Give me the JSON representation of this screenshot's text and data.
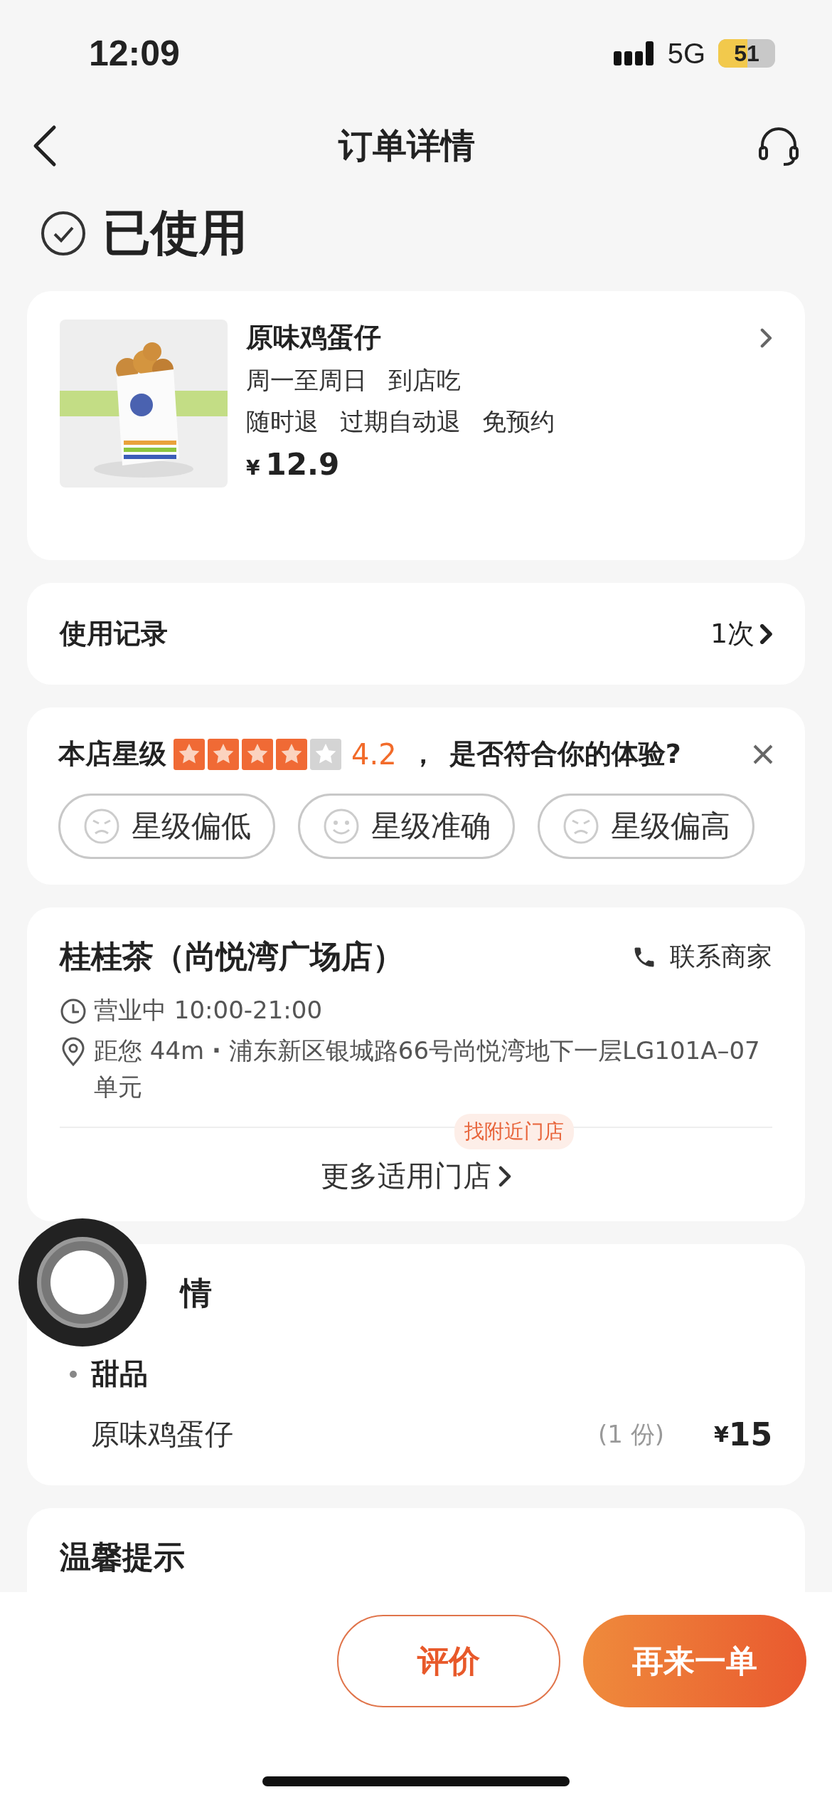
{
  "status_bar": {
    "time": "12:09",
    "network": "5G",
    "battery": "51"
  },
  "nav": {
    "title": "订单详情"
  },
  "order_status": {
    "label": "已使用",
    "done": true
  },
  "product": {
    "name": "原味鸡蛋仔",
    "tags_line1": [
      "周一至周日",
      "到店吃"
    ],
    "tags_line2": [
      "随时退",
      "过期自动退",
      "免预约"
    ],
    "currency": "¥",
    "price": "12.9",
    "image": {
      "kind": "picture"
    }
  },
  "usage": {
    "label": "使用记录",
    "value": "1次"
  },
  "rating": {
    "label": "本店星级",
    "stars": 4,
    "score": "4.2",
    "separator": "，",
    "question": "是否符合你的体验?",
    "options": [
      {
        "label": "星级偏低",
        "kind": "sad"
      },
      {
        "label": "星级准确",
        "kind": "smile"
      },
      {
        "label": "星级偏高",
        "kind": "sad"
      }
    ]
  },
  "store": {
    "name": "桂桂茶（尚悦湾广场店）",
    "contact": "联系商家",
    "hours": "营业中 10:00-21:00",
    "distance": "距您 44m",
    "separator": "·",
    "address": "浦东新区银城路66号尚悦湾地下一层LG101A–07单元",
    "nearby_badge": "找附近门店",
    "more_stores": "更多适用门店"
  },
  "details": {
    "title": "情",
    "category": "甜品",
    "items": [
      {
        "name": "原味鸡蛋仔",
        "qty": "(1 份)",
        "currency": "¥",
        "price": "15"
      }
    ]
  },
  "tips": {
    "title": "温馨提示"
  },
  "actions": [
    {
      "label": "评价",
      "kind": "outline"
    },
    {
      "label": "再来一单",
      "kind": "primary"
    }
  ]
}
